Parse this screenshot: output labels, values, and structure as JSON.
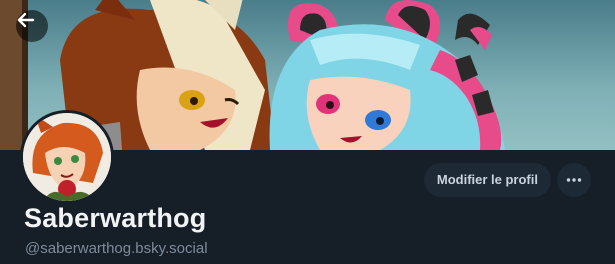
{
  "profile": {
    "display_name": "Saberwarthog",
    "handle": "@saberwarthog.bsky.social"
  },
  "actions": {
    "edit_label": "Modifier le profil"
  },
  "icons": {
    "back": "arrow-left-icon",
    "more": "ellipsis-icon"
  },
  "colors": {
    "background": "#161e27",
    "button_bg": "#1e2936",
    "name_text": "#f1f3f5",
    "handle_text": "#7d8c9b"
  }
}
